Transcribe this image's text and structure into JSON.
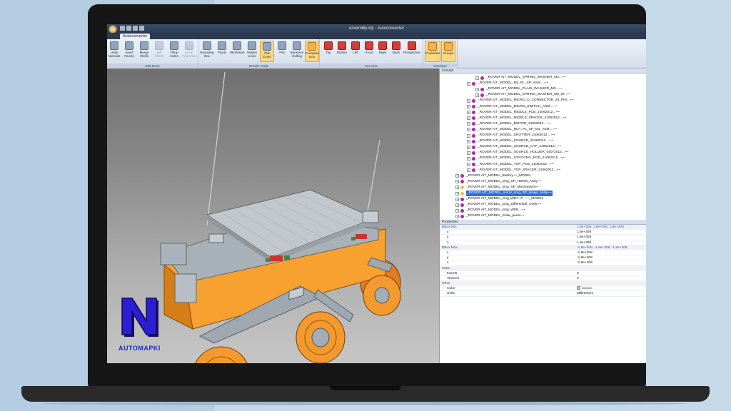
{
  "window": {
    "title": "assembly.stp - Autoconverter"
  },
  "tabs": [
    {
      "label": "Autoconverter"
    }
  ],
  "ribbon": {
    "groups": [
      {
        "label": "Edit Mesh",
        "buttons": [
          "Unify Normals",
          "Invert Facets",
          "Merge Shells",
          "Split Shells",
          "Fillup Holes",
          "Mesh Properties"
        ]
      },
      {
        "label": "Render Mode",
        "buttons": [
          "Bounding Box",
          "Points",
          "Wireframe",
          "Hidden Lines",
          "Flat Lines",
          "Flat",
          "Backface Culling",
          "Compass Icon"
        ]
      },
      {
        "label": "Set View",
        "buttons": [
          "Top",
          "Bottom",
          "Left",
          "Front",
          "Right",
          "Back",
          "Perspective"
        ]
      },
      {
        "label": "Windows",
        "buttons": [
          "Properties",
          "Groups"
        ]
      }
    ]
  },
  "groups_panel": {
    "title": "Groups",
    "items": [
      "_ROVER AIT_MODEL_SPRING_WASHER_M3...~~",
      "_ROVER AIT_MODEL_M3_PL_SP_ASM....~~",
      "_ROVER AIT_MODEL_PLAIN_WASHER_M3...~~",
      "_ROVER AIT_MODEL_SPRING_WASHER_M3_W...~~",
      "_ROVER AIT_MODEL_MICRO_D_CONNECTOR_25_PIN...~~",
      "_ROVER AIT_MODEL_MICRO_SWITCH_ASM....~~",
      "_ROVER AIT_MODEL_MIDDLE_PCB_21062012...~~",
      "_ROVER AIT_MODEL_MIDDLE_SPACER_21062012...~~",
      "_ROVER AIT_MODEL_MOTOR_21062012....~~",
      "_ROVER AIT_MODEL_NUT_PL_SP_M4_ASM....~~",
      "_ROVER AIT_MODEL_SHUTTER_21062012....~~",
      "_ROVER AIT_MODEL_SOURCE_21062012....~~",
      "_ROVER AIT_MODEL_SOURCE_CAP_21062012...~~",
      "_ROVER AIT_MODEL_SOURCE_HOLDER_04072012...~~",
      "_ROVER AIT_MODEL_STACKING_ROD_21062012...~~",
      "_ROVER AIT_MODEL_TOP_PCB_21062012...~~",
      "_ROVER AIT_MODEL_TOP_SPACER_21062012...~~",
      "_ROVER AIT_MODEL_Battery~~_MODEL",
      "_ROVER AIT_MODEL_smg_SP_HDRM_Assly~~",
      "_ROVER AIT_MODEL_smg_SP_Mechanism~~",
      "_ROVER AIT_MODEL_mirror_smg_SP_Hinge_Assly~~",
      "_ROVER AIT_MODEL_smg_WDA~P...~~_MODEL",
      "_ROVER AIT_MODEL_smg_Differential_Assly~~",
      "_ROVER AIT_MODEL_smg_WEB...~~",
      "_ROVER AIT_MODEL_Solar_panel~~"
    ],
    "selected_index": 20
  },
  "properties_panel": {
    "title": "Properties",
    "rows": [
      {
        "type": "cat",
        "key": "BBox Min",
        "value": "1.8e+308, 1.8e+308, 1.8e+308"
      },
      {
        "type": "row",
        "key": "x",
        "value": "1.8e+308"
      },
      {
        "type": "row",
        "key": "y",
        "value": "1.8e+308"
      },
      {
        "type": "row",
        "key": "z",
        "value": "1.8e+308"
      },
      {
        "type": "cat",
        "key": "BBox Max",
        "value": "-1.8e+308, -1.8e+308, -1.8e+308"
      },
      {
        "type": "row",
        "key": "x",
        "value": "-1.8e+308"
      },
      {
        "type": "row",
        "key": "y",
        "value": "-1.8e+308"
      },
      {
        "type": "row",
        "key": "z",
        "value": "-1.8e+308"
      },
      {
        "type": "cat",
        "key": "Stats",
        "value": ""
      },
      {
        "type": "row",
        "key": "Facets",
        "value": "0"
      },
      {
        "type": "row",
        "key": "Vertices",
        "value": "0"
      },
      {
        "type": "cat",
        "key": "Other",
        "value": ""
      },
      {
        "type": "row",
        "key": "Color",
        "value": "cccccc",
        "swatch": true
      },
      {
        "type": "row",
        "key": "Units",
        "value": "Millimeters"
      }
    ]
  },
  "brand": {
    "logo_letter": "N",
    "name": "AUTOMAPKI"
  },
  "colors": {
    "accent": "#f7a130",
    "selection": "#2f6fd4",
    "logo": "#1d2fbf"
  }
}
